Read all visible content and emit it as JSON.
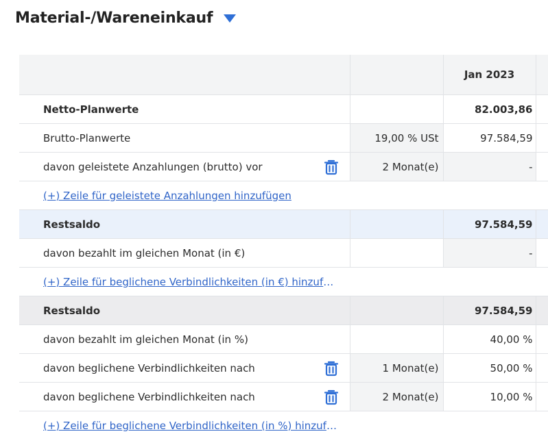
{
  "section": {
    "title": "Material-/Wareneinkauf"
  },
  "table": {
    "header_month": "Jan 2023",
    "rows": {
      "netto": {
        "label": "Netto-Planwerte",
        "mid": "",
        "value": "82.003,86"
      },
      "brutto": {
        "label": "Brutto-Planwerte",
        "mid": "19,00 % USt",
        "value": "97.584,59"
      },
      "anzahlung": {
        "label": "davon geleistete Anzahlungen (brutto) vor",
        "mid": "2 Monat(e)",
        "value": "-"
      },
      "add_anzahlung": {
        "label": "(+) Zeile für geleistete Anzahlungen hinzufügen"
      },
      "restsaldo1": {
        "label": "Restsaldo",
        "mid": "",
        "value": "97.584,59"
      },
      "bezahlt_eur": {
        "label": "davon bezahlt im gleichen Monat (in €)",
        "mid": "",
        "value": "-"
      },
      "add_eur": {
        "label": "(+) Zeile für beglichene Verbindlichkeiten (in €) hinzufügen"
      },
      "restsaldo2": {
        "label": "Restsaldo",
        "mid": "",
        "value": "97.584,59"
      },
      "bezahlt_pct": {
        "label": "davon bezahlt im gleichen Monat (in %)",
        "mid": "",
        "value": "40,00 %"
      },
      "beglichen1": {
        "label": "davon beglichene Verbindlichkeiten nach",
        "mid": "1 Monat(e)",
        "value": "50,00 %"
      },
      "beglichen2": {
        "label": "davon beglichene Verbindlichkeiten nach",
        "mid": "2 Monat(e)",
        "value": "10,00 %"
      },
      "add_pct": {
        "label": "(+) Zeile für beglichene Verbindlichkeiten (in %) hinzufügen"
      }
    }
  },
  "icons": {
    "caret": "caret-down-icon",
    "trash": "trash-icon"
  },
  "colors": {
    "accent": "#2f6fd6",
    "link": "#2f64c8",
    "header_bg": "#f3f4f5",
    "restsaldo_blue": "#eaf1fb",
    "restsaldo_gray": "#ececee"
  }
}
